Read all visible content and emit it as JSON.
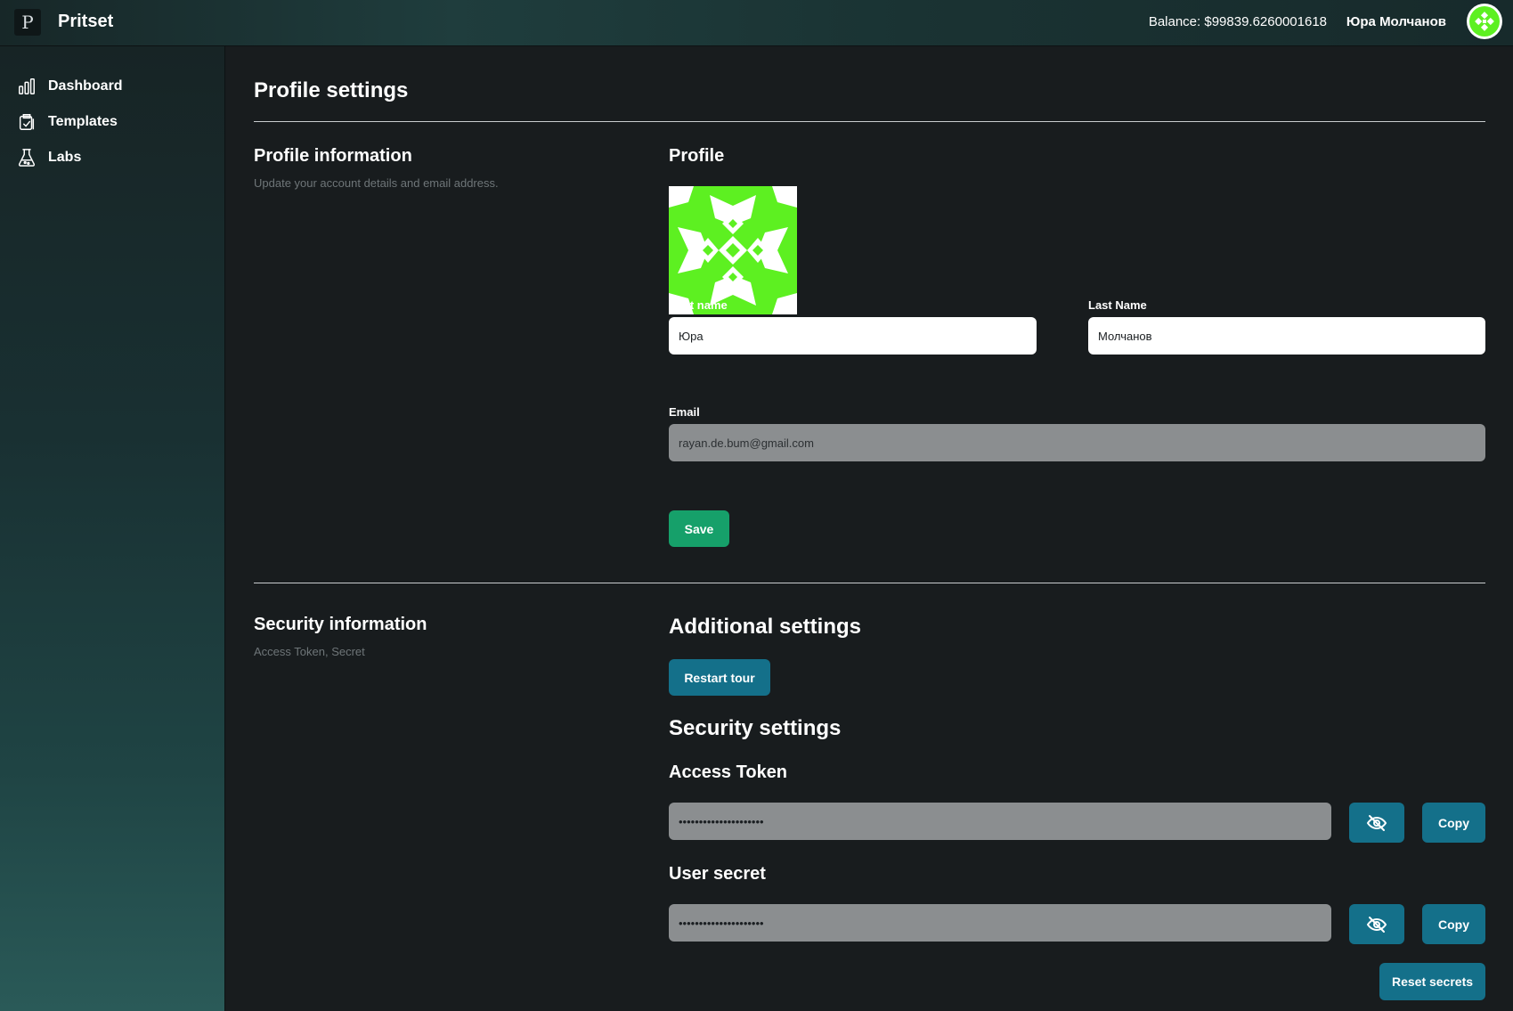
{
  "header": {
    "logo_letter": "P",
    "app_name": "Pritset",
    "balance": "Balance: $99839.6260001618",
    "user_name": "Юра Молчанов",
    "avatar_icon": "avatar-icon"
  },
  "sidebar": {
    "items": [
      {
        "label": "Dashboard",
        "icon": "bar-chart-icon"
      },
      {
        "label": "Templates",
        "icon": "clipboard-check-icon"
      },
      {
        "label": "Labs",
        "icon": "flask-icon"
      }
    ]
  },
  "main": {
    "page_title": "Profile settings",
    "profile_section": {
      "title": "Profile information",
      "subtitle": "Update your account details and email address.",
      "profile_heading": "Profile",
      "first_name_label": "First name",
      "first_name_value": "Юра",
      "last_name_label": "Last Name",
      "last_name_value": "Молчанов",
      "email_label": "Email",
      "email_value": "rayan.de.bum@gmail.com",
      "save_label": "Save"
    },
    "security_section": {
      "title": "Security information",
      "subtitle": "Access Token, Secret",
      "additional_heading": "Additional settings",
      "restart_tour_label": "Restart tour",
      "security_heading": "Security settings",
      "access_token_heading": "Access Token",
      "access_token_value": "•••••••••••••••••••••",
      "user_secret_heading": "User secret",
      "user_secret_value": "•••••••••••••••••••••",
      "copy_label": "Copy",
      "reset_label": "Reset secrets"
    }
  },
  "colors": {
    "accent_green": "#16a06a",
    "accent_blue": "#14708a",
    "avatar_green": "#5df021"
  }
}
